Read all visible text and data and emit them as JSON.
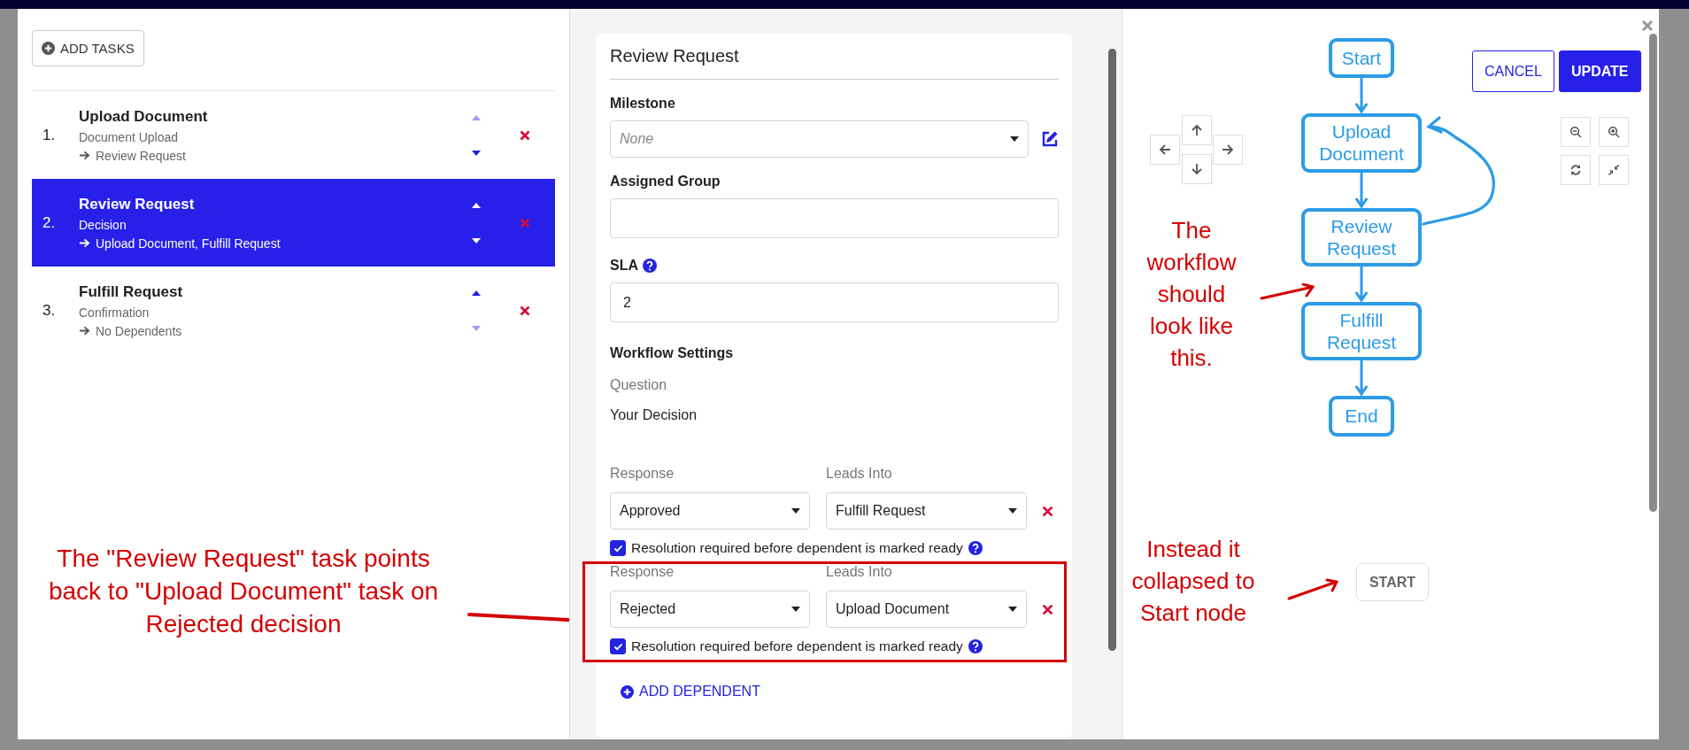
{
  "task_panel": {
    "add_button": "ADD TASKS",
    "tasks": [
      {
        "number": "1.",
        "title": "Upload Document",
        "type": "Document Upload",
        "dependents": "Review Request",
        "selected": false,
        "up_disabled": true,
        "down_disabled": false
      },
      {
        "number": "2.",
        "title": "Review Request",
        "type": "Decision",
        "dependents": "Upload Document, Fulfill Request",
        "selected": true,
        "up_disabled": false,
        "down_disabled": false
      },
      {
        "number": "3.",
        "title": "Fulfill Request",
        "type": "Confirmation",
        "dependents": "No Dependents",
        "selected": false,
        "up_disabled": false,
        "down_disabled": true
      }
    ]
  },
  "details": {
    "title": "Review Request",
    "milestone": {
      "label": "Milestone",
      "placeholder": "None"
    },
    "assigned_group": {
      "label": "Assigned Group"
    },
    "sla": {
      "label": "SLA",
      "value": "2"
    },
    "workflow_heading": "Workflow Settings",
    "question_label": "Question",
    "question": "Your Decision",
    "dependents": [
      {
        "response_label": "Response",
        "response": "Approved",
        "leads_label": "Leads Into",
        "leads_into": "Fulfill Request",
        "resolution_required": true,
        "resolution_text": "Resolution required before dependent is marked ready",
        "highlighted": false
      },
      {
        "response_label": "Response",
        "response": "Rejected",
        "leads_label": "Leads Into",
        "leads_into": "Upload Document",
        "resolution_required": true,
        "resolution_text": "Resolution required before dependent is marked ready",
        "highlighted": true
      }
    ],
    "add_dependent": "ADD DEPENDENT"
  },
  "workflow_panel": {
    "cancel": "CANCEL",
    "update": "UPDATE",
    "start_node": "START"
  },
  "annotations": {
    "expected_flow": [
      "Start",
      "Upload Document",
      "Review Request",
      "Fulfill Request",
      "End"
    ],
    "notes": [
      {
        "text": "The \"Review Request\" task points back to \"Upload Document\" task on Rejected decision"
      },
      {
        "text": "The workflow should look like this."
      },
      {
        "text": "Instead it collapsed to Start node"
      }
    ]
  }
}
